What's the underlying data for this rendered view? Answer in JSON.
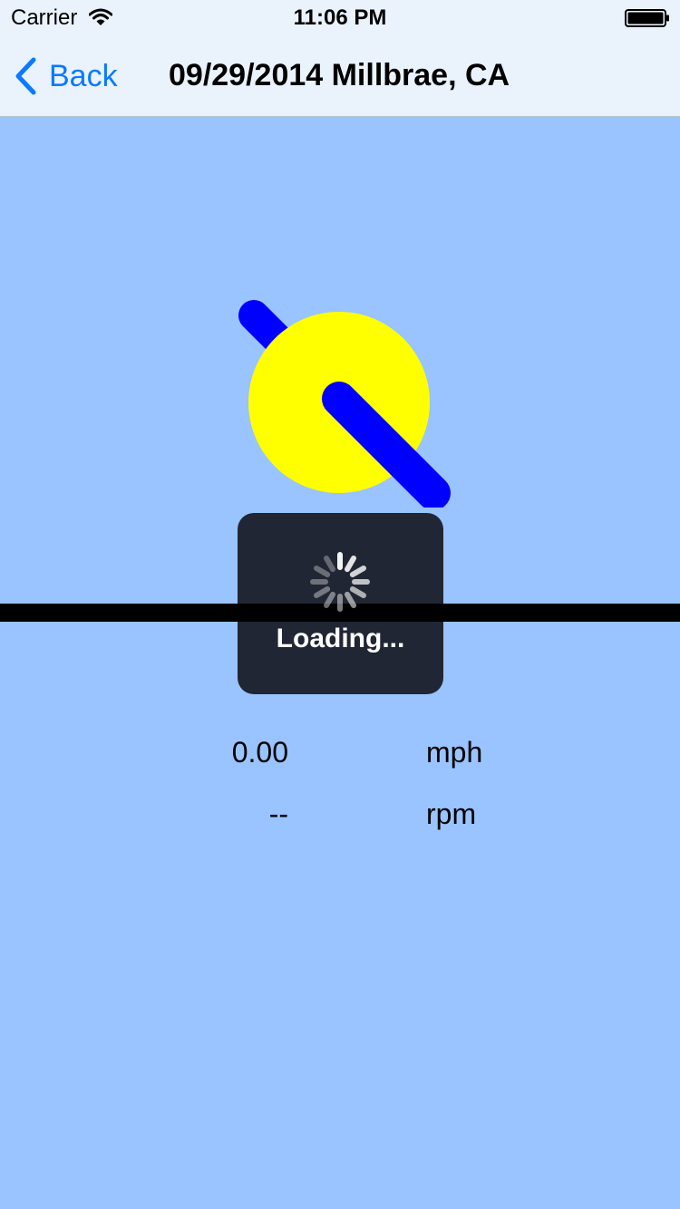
{
  "status_bar": {
    "carrier": "Carrier",
    "time": "11:06 PM",
    "wifi_icon": "wifi-icon",
    "battery_icon": "battery-icon"
  },
  "nav": {
    "back_label": "Back",
    "back_icon": "chevron-left-icon",
    "title": "09/29/2014 Millbrae, CA"
  },
  "gauge": {
    "dial_color": "#ffff00",
    "pointer_color": "#0000ff"
  },
  "loading": {
    "label": "Loading...",
    "spinner_icon": "activity-spinner-icon"
  },
  "readouts": [
    {
      "value": "0.00",
      "unit": "mph"
    },
    {
      "value": "--",
      "unit": "rpm"
    }
  ],
  "colors": {
    "background": "#99c4ff",
    "accent": "#0a7aff",
    "hud": "#212634"
  }
}
